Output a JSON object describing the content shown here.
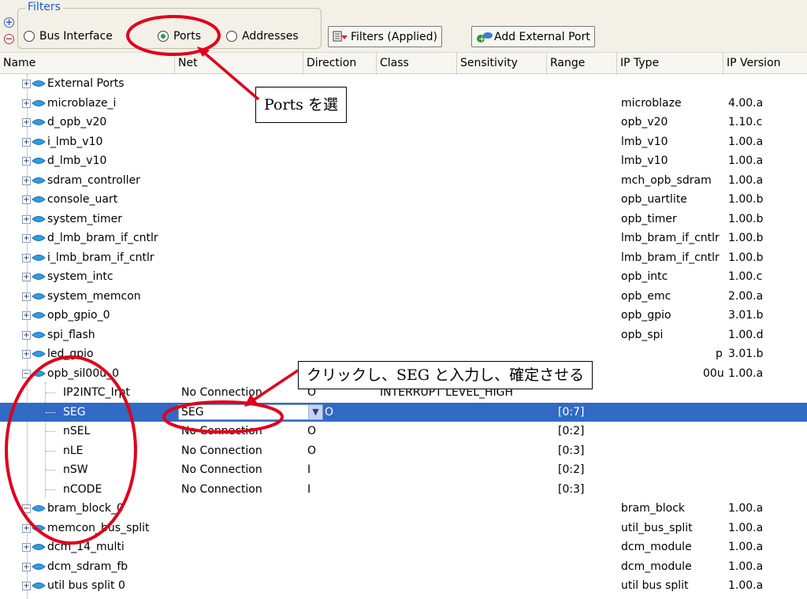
{
  "filters": {
    "legend": "Filters",
    "radios": [
      {
        "label": "Bus Interface",
        "selected": false
      },
      {
        "label": "Ports",
        "selected": true
      },
      {
        "label": "Addresses",
        "selected": false
      }
    ],
    "filters_button": "Filters (Applied)",
    "add_port_button": "Add External Port"
  },
  "columns": [
    "Name",
    "Net",
    "Direction",
    "Class",
    "Sensitivity",
    "Range",
    "IP Type",
    "IP Version"
  ],
  "rows": [
    {
      "name": "External Ports",
      "type": "",
      "version": ""
    },
    {
      "name": "microblaze_i",
      "type": "microblaze",
      "version": "4.00.a"
    },
    {
      "name": "d_opb_v20",
      "type": "opb_v20",
      "version": "1.10.c"
    },
    {
      "name": "i_lmb_v10",
      "type": "lmb_v10",
      "version": "1.00.a"
    },
    {
      "name": "d_lmb_v10",
      "type": "lmb_v10",
      "version": "1.00.a"
    },
    {
      "name": "sdram_controller",
      "type": "mch_opb_sdram",
      "version": "1.00.a"
    },
    {
      "name": "console_uart",
      "type": "opb_uartlite",
      "version": "1.00.b"
    },
    {
      "name": "system_timer",
      "type": "opb_timer",
      "version": "1.00.b"
    },
    {
      "name": "d_lmb_bram_if_cntlr",
      "type": "lmb_bram_if_cntlr",
      "version": "1.00.b"
    },
    {
      "name": "i_lmb_bram_if_cntlr",
      "type": "lmb_bram_if_cntlr",
      "version": "1.00.b"
    },
    {
      "name": "system_intc",
      "type": "opb_intc",
      "version": "1.00.c"
    },
    {
      "name": "system_memcon",
      "type": "opb_emc",
      "version": "2.00.a"
    },
    {
      "name": "opb_gpio_0",
      "type": "opb_gpio",
      "version": "3.01.b"
    },
    {
      "name": "spi_flash",
      "type": "opb_spi",
      "version": "1.00.d"
    },
    {
      "name": "led_gpio",
      "type": "p",
      "version": "3.01.b"
    },
    {
      "name": "opb_sil00u_0",
      "type": "00u",
      "version": "1.00.a"
    }
  ],
  "ports": [
    {
      "name": "IP2INTC_Irpt",
      "net": "No Connection",
      "dir": "O",
      "class": "INTERRUPT LEVEL_HIGH",
      "range": ""
    },
    {
      "name": "SEG",
      "net": "SEG",
      "dir": "O",
      "class": "",
      "range": "[0:7]"
    },
    {
      "name": "nSEL",
      "net": "No Connection",
      "dir": "O",
      "class": "",
      "range": "[0:2]"
    },
    {
      "name": "nLE",
      "net": "No Connection",
      "dir": "O",
      "class": "",
      "range": "[0:3]"
    },
    {
      "name": "nSW",
      "net": "No Connection",
      "dir": "I",
      "class": "",
      "range": "[0:2]"
    },
    {
      "name": "nCODE",
      "net": "No Connection",
      "dir": "I",
      "class": "",
      "range": "[0:3]"
    }
  ],
  "rows_after": [
    {
      "name": "bram_block_0",
      "type": "bram_block",
      "version": "1.00.a"
    },
    {
      "name": "memcon_bus_split",
      "type": "util_bus_split",
      "version": "1.00.a"
    },
    {
      "name": "dcm_14_multi",
      "type": "dcm_module",
      "version": "1.00.a"
    },
    {
      "name": "dcm_sdram_fb",
      "type": "dcm_module",
      "version": "1.00.a"
    },
    {
      "name": "util bus split 0",
      "type": "util bus split",
      "version": "1.00.a"
    }
  ],
  "callouts": {
    "ports": "Ports を選",
    "seg": "クリックし、SEG と入力し、確定させる"
  },
  "colors": {
    "accent": "#316ac5",
    "annotation": "#e0001b",
    "legend": "#1f5fc7"
  }
}
